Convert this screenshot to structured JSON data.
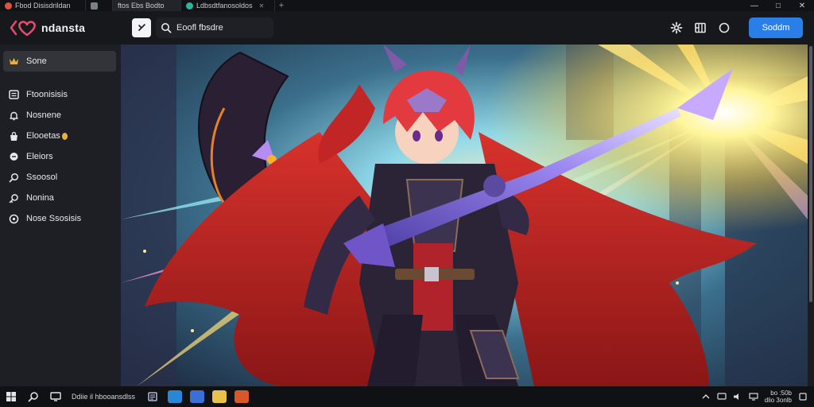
{
  "browser": {
    "tabs": [
      {
        "title": "Fbod Disisdrildan",
        "favicon_color": "#e0533a",
        "active": false
      },
      {
        "title": "",
        "favicon_color": "#7c7f88",
        "active": false
      },
      {
        "title": "ftos Ebs Bodto",
        "favicon_color": "#b0b0b8",
        "active": true
      },
      {
        "title": "Ldbsdtfanosoldos",
        "favicon_color": "#2fb39a",
        "active": false
      }
    ],
    "new_tab": "+",
    "window_controls": {
      "minimize": "—",
      "maximize": "□",
      "close": "✕"
    }
  },
  "header": {
    "brand": "ndansta",
    "search_text": "Eoofl fbsdre",
    "signin_label": "Soddm"
  },
  "sidebar": {
    "items": [
      {
        "label": "Sone",
        "icon": "crown-icon",
        "active": true
      },
      {
        "label": "Ftoonisisis",
        "icon": "list-icon",
        "active": false
      },
      {
        "label": "Nosnene",
        "icon": "bell-icon",
        "active": false
      },
      {
        "label": "Elooetas",
        "icon": "bag-icon",
        "coin": true,
        "active": false
      },
      {
        "label": "Eleiors",
        "icon": "chat-icon",
        "active": false
      },
      {
        "label": "Ssoosol",
        "icon": "search-icon",
        "active": false
      },
      {
        "label": "Nonina",
        "icon": "key-icon",
        "active": false
      },
      {
        "label": "Nose Ssosisis",
        "icon": "circle-icon",
        "active": false
      }
    ]
  },
  "taskbar": {
    "search_text": "Ddiie il hbooansdlss",
    "apps": [
      "files-app",
      "edge-app",
      "word-app",
      "folder-app",
      "game-app"
    ],
    "clock_time": "bo :50b",
    "clock_date": "dlio 3onlb"
  },
  "colors": {
    "accent": "#2a7ee8",
    "brand_heart": "#e64b6e",
    "sidebar_bg": "#1e1f24",
    "header_bg": "#17181c"
  },
  "artwork": {
    "subject": "anime-warrior-illustration"
  }
}
